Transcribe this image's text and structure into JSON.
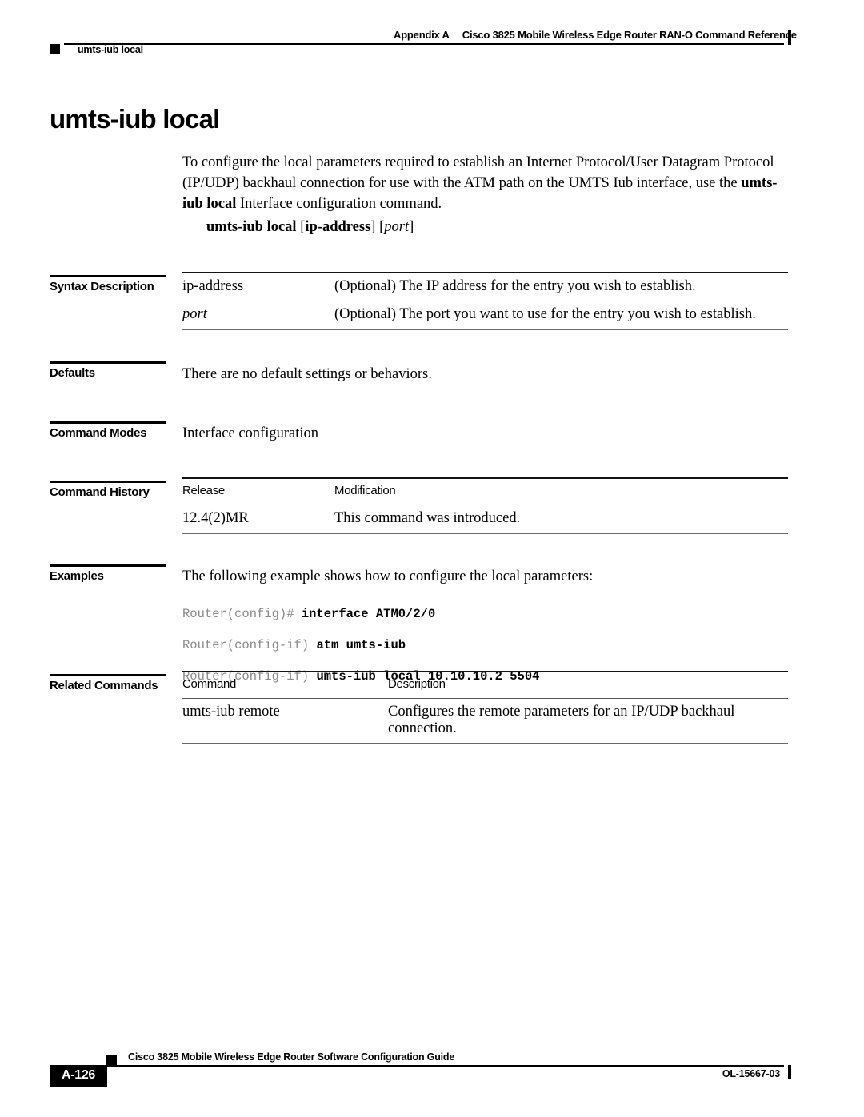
{
  "header": {
    "chapter_label": "Appendix A",
    "chapter_title": "Cisco 3825 Mobile Wireless Edge Router RAN-O Command Reference",
    "running_command": "umts-iub local"
  },
  "page_title": "umts-iub local",
  "intro": {
    "text_1": "To configure the local parameters required to establish an Internet Protocol/User Datagram Protocol (IP/UDP) backhaul connection for use with the ATM path on the UMTS Iub interface, use the ",
    "bold_1": "umts-iub local",
    "text_2": " Interface configuration command."
  },
  "syntax": {
    "command": "umts-iub local",
    "open_bracket_1": " [",
    "arg_1": "ip-address",
    "close_bracket_1": "] ",
    "open_bracket_2": "[",
    "arg_2": "port",
    "close_bracket_2": "]"
  },
  "sections": {
    "syntax_description": {
      "label": "Syntax Description",
      "rows": [
        {
          "term": "ip-address",
          "desc": "(Optional) The IP address for the entry you wish to establish."
        },
        {
          "term": "port",
          "desc": "(Optional) The port you want to use for the entry you wish to establish."
        }
      ]
    },
    "defaults": {
      "label": "Defaults",
      "body": "There are no default settings or behaviors."
    },
    "command_modes": {
      "label": "Command Modes",
      "body": "Interface configuration"
    },
    "command_history": {
      "label": "Command History",
      "headers": {
        "release": "Release",
        "modification": "Modification"
      },
      "rows": [
        {
          "release": "12.4(2)MR",
          "modification": "This command was introduced."
        }
      ]
    },
    "examples": {
      "label": "Examples",
      "body": "The following example shows how to configure the local parameters:",
      "code_lines": [
        {
          "prompt": "Router(config)# ",
          "command": "interface ATM0/2/0"
        },
        {
          "prompt": "Router(config-if) ",
          "command": "atm umts-iub"
        },
        {
          "prompt": "Router(config-if) ",
          "command": "umts-iub local 10.10.10.2 5504"
        }
      ]
    },
    "related_commands": {
      "label": "Related Commands",
      "headers": {
        "command": "Command",
        "description": "Description"
      },
      "rows": [
        {
          "command": "umts-iub remote",
          "description": "Configures the remote parameters for an IP/UDP backhaul connection."
        }
      ]
    }
  },
  "footer": {
    "page_number": "A-126",
    "guide_title": "Cisco 3825 Mobile Wireless Edge Router Software Configuration Guide",
    "doc_number": "OL-15667-03"
  }
}
